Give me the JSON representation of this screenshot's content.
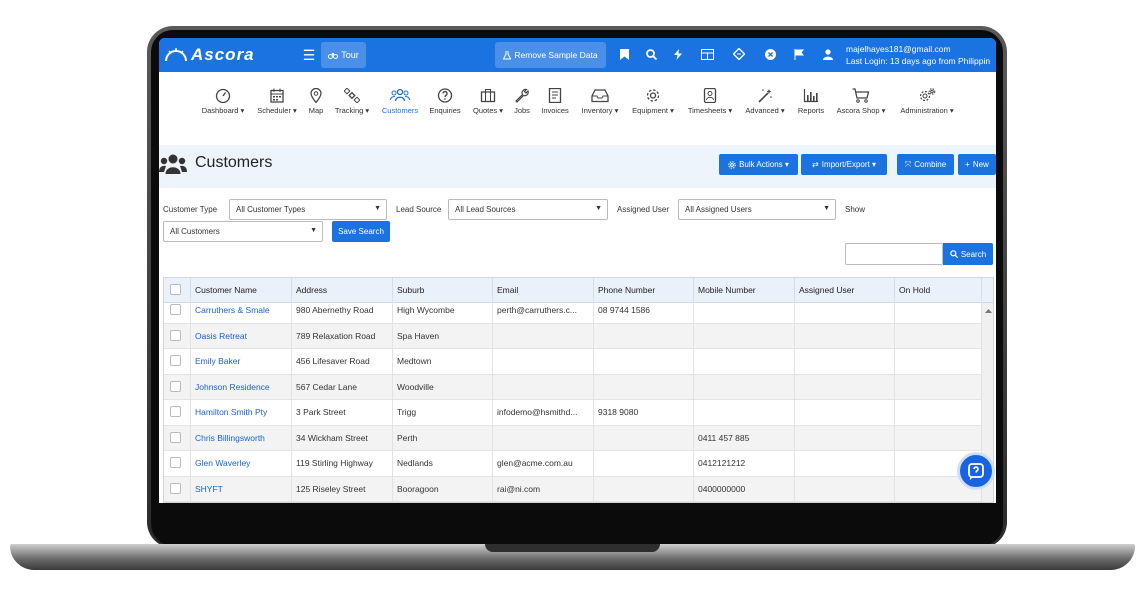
{
  "app": {
    "logo_text": "Ascora"
  },
  "topbar": {
    "tour_label": "Tour",
    "remove_sample_label": "Remove Sample Data",
    "user_email": "majelhayes181@gmail.com",
    "last_login": "Last Login: 13 days ago from Philippin"
  },
  "nav": {
    "items": [
      {
        "label": "Dashboard ▾",
        "icon": "speedometer-icon"
      },
      {
        "label": "Scheduler ▾",
        "icon": "calendar-icon"
      },
      {
        "label": "Map",
        "icon": "map-pin-icon"
      },
      {
        "label": "Tracking ▾",
        "icon": "satellite-icon"
      },
      {
        "label": "Customers",
        "icon": "people-icon"
      },
      {
        "label": "Enquiries",
        "icon": "question-icon"
      },
      {
        "label": "Quotes ▾",
        "icon": "briefcase-icon"
      },
      {
        "label": "Jobs",
        "icon": "wrench-icon"
      },
      {
        "label": "Invoices",
        "icon": "invoice-icon"
      },
      {
        "label": "Inventory ▾",
        "icon": "inbox-icon"
      },
      {
        "label": "Equipment ▾",
        "icon": "gear-icon"
      },
      {
        "label": "Timesheets ▾",
        "icon": "timesheet-icon"
      },
      {
        "label": "Advanced ▾",
        "icon": "magic-wand-icon"
      },
      {
        "label": "Reports",
        "icon": "bar-chart-icon"
      },
      {
        "label": "Ascora Shop ▾",
        "icon": "cart-icon"
      },
      {
        "label": "Administration ▾",
        "icon": "gears-icon"
      }
    ]
  },
  "page": {
    "title": "Customers",
    "bulk_actions": "Bulk Actions ▾",
    "import_export": "Import/Export ▾",
    "combine": "Combine",
    "new": "New"
  },
  "filters": {
    "customer_type_label": "Customer Type",
    "customer_type_value": "All Customer Types",
    "lead_source_label": "Lead Source",
    "lead_source_value": "All Lead Sources",
    "assigned_user_label": "Assigned User",
    "assigned_user_value": "All Assigned Users",
    "show_label": "Show",
    "show_value": "All Customers",
    "save_search": "Save Search",
    "search_button": "Search",
    "search_value": ""
  },
  "table": {
    "headers": [
      "Customer Name",
      "Address",
      "Suburb",
      "Email",
      "Phone Number",
      "Mobile Number",
      "Assigned User",
      "On Hold"
    ],
    "rows": [
      {
        "name": "Carruthers & Smale",
        "address": "980 Abernethy Road",
        "suburb": "High Wycombe",
        "email": "perth@carruthers.c...",
        "phone": "08 9744 1586",
        "mobile": "",
        "assigned": "",
        "hold": ""
      },
      {
        "name": "Oasis Retreat",
        "address": "789 Relaxation Road",
        "suburb": "Spa Haven",
        "email": "",
        "phone": "",
        "mobile": "",
        "assigned": "",
        "hold": ""
      },
      {
        "name": "Emily Baker",
        "address": "456 Lifesaver Road",
        "suburb": "Medtown",
        "email": "",
        "phone": "",
        "mobile": "",
        "assigned": "",
        "hold": ""
      },
      {
        "name": "Johnson Residence",
        "address": "567 Cedar Lane",
        "suburb": "Woodville",
        "email": "",
        "phone": "",
        "mobile": "",
        "assigned": "",
        "hold": ""
      },
      {
        "name": "Hamilton Smith Pty",
        "address": "3 Park Street",
        "suburb": "Trigg",
        "email": "infodemo@hsmithd...",
        "phone": "9318 9080",
        "mobile": "",
        "assigned": "",
        "hold": ""
      },
      {
        "name": "Chris Billingsworth",
        "address": "34 Wickham Street",
        "suburb": "Perth",
        "email": "",
        "phone": "",
        "mobile": "0411 457 885",
        "assigned": "",
        "hold": ""
      },
      {
        "name": "Glen Waverley",
        "address": "119 Stirling Highway",
        "suburb": "Nedlands",
        "email": "glen@acme.com.au",
        "phone": "",
        "mobile": "0412121212",
        "assigned": "",
        "hold": ""
      },
      {
        "name": "SHYFT",
        "address": "125 Riseley Street",
        "suburb": "Booragoon",
        "email": "rai@ni.com",
        "phone": "",
        "mobile": "0400000000",
        "assigned": "",
        "hold": ""
      }
    ]
  },
  "colors": {
    "primary": "#1a73e0",
    "link": "#1a63c8",
    "header_bg": "#e9f1fb"
  }
}
